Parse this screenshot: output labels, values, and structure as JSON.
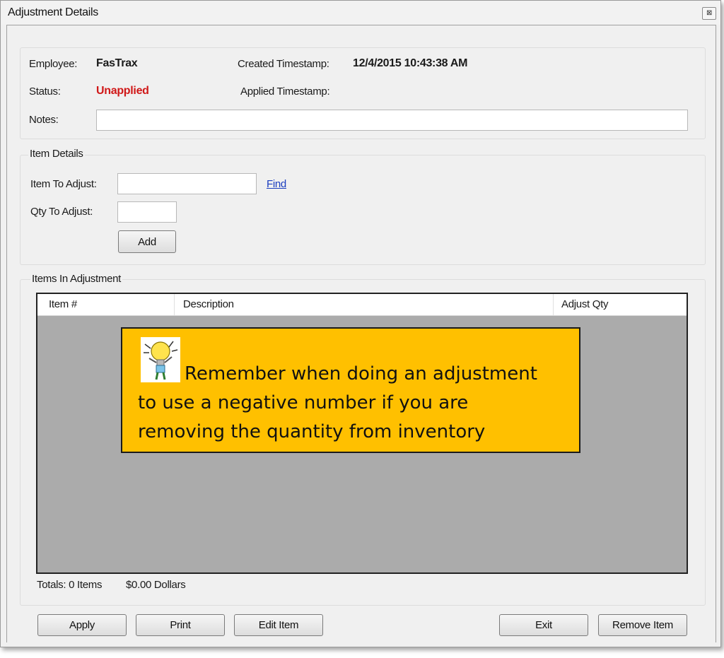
{
  "window": {
    "title": "Adjustment Details",
    "close_glyph": "⊠"
  },
  "header": {
    "employee_label": "Employee:",
    "employee_value": "FasTrax",
    "status_label": "Status:",
    "status_value": "Unapplied",
    "created_label": "Created Timestamp:",
    "created_value": "12/4/2015 10:43:38 AM",
    "applied_label": "Applied Timestamp:",
    "notes_label": "Notes:",
    "notes_value": ""
  },
  "item_details": {
    "legend": "Item Details",
    "item_label": "Item To Adjust:",
    "item_value": "",
    "find_link": "Find",
    "qty_label": "Qty To Adjust:",
    "qty_value": "",
    "add_button": "Add"
  },
  "items_group": {
    "legend": "Items In Adjustment",
    "columns": [
      "Item #",
      "Description",
      "Adjust Qty"
    ],
    "rows": []
  },
  "callout": {
    "line1": "Remember when doing an adjustment",
    "line2": "to use a negative number if you are",
    "line3": "removing the quantity from inventory",
    "icon": "lightbulb-mascot-icon",
    "bg_color": "#ffc000"
  },
  "totals": {
    "items": "Totals: 0 Items",
    "dollars": "$0.00 Dollars"
  },
  "buttons": {
    "apply": "Apply",
    "print": "Print",
    "edit_item": "Edit Item",
    "exit": "Exit",
    "remove_item": "Remove Item"
  },
  "colors": {
    "status_red": "#d01818",
    "link_blue": "#1a3dbf",
    "grid_bg": "#ababab"
  }
}
